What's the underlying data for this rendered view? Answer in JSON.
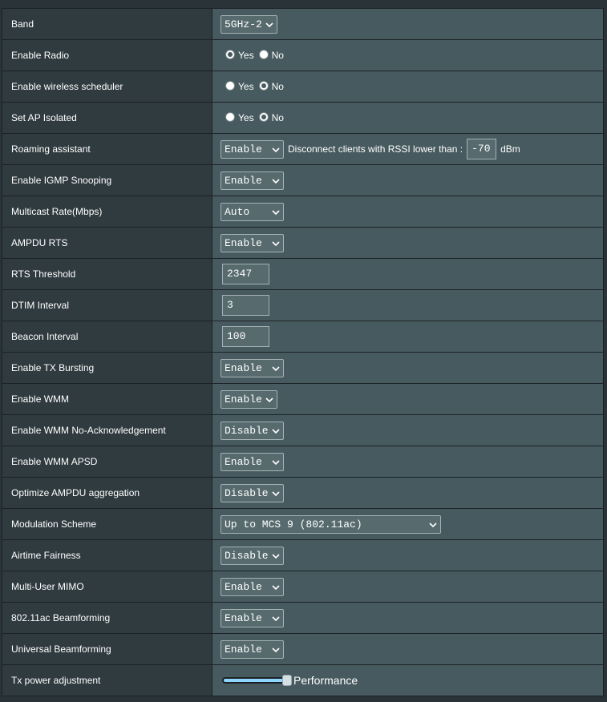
{
  "rows": [
    {
      "label": "Band",
      "value": "5GHz-2"
    },
    {
      "label": "Enable Radio",
      "yes": "Yes",
      "no": "No",
      "selected": "Yes"
    },
    {
      "label": "Enable wireless scheduler",
      "yes": "Yes",
      "no": "No",
      "selected": "No"
    },
    {
      "label": "Set AP Isolated",
      "yes": "Yes",
      "no": "No",
      "selected": "No"
    },
    {
      "label": "Roaming assistant",
      "value": "Enable",
      "text": "Disconnect clients with RSSI lower than :",
      "rssi": "-70",
      "unit": "dBm"
    },
    {
      "label": "Enable IGMP Snooping",
      "value": "Enable"
    },
    {
      "label": "Multicast Rate(Mbps)",
      "value": "Auto"
    },
    {
      "label": "AMPDU RTS",
      "value": "Enable"
    },
    {
      "label": "RTS Threshold",
      "value": "2347"
    },
    {
      "label": "DTIM Interval",
      "value": "3"
    },
    {
      "label": "Beacon Interval",
      "value": "100"
    },
    {
      "label": "Enable TX Bursting",
      "value": "Enable"
    },
    {
      "label": "Enable WMM",
      "value": "Enable"
    },
    {
      "label": "Enable WMM No-Acknowledgement",
      "value": "Disable"
    },
    {
      "label": "Enable WMM APSD",
      "value": "Enable"
    },
    {
      "label": "Optimize AMPDU aggregation",
      "value": "Disable"
    },
    {
      "label": "Modulation Scheme",
      "value": "Up to MCS 9 (802.11ac)"
    },
    {
      "label": "Airtime Fairness",
      "value": "Disable"
    },
    {
      "label": "Multi-User MIMO",
      "value": "Enable"
    },
    {
      "label": "802.11ac Beamforming",
      "value": "Enable"
    },
    {
      "label": "Universal Beamforming",
      "value": "Enable"
    },
    {
      "label": "Tx power adjustment",
      "level": 1.0,
      "level_label": "Performance"
    }
  ],
  "colors": {
    "page_background": "#2a3438",
    "label_cell": "#303b3f",
    "value_cell": "#475a5f",
    "control_fill": "#576b6f",
    "slider_fill": "#8fd6ff"
  },
  "icons": {
    "select_arrow": "chevron-down-icon"
  }
}
